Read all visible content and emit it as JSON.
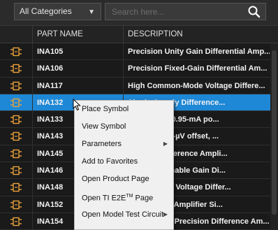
{
  "toolbar": {
    "category_value": "All Categories",
    "search_placeholder": "Search here...",
    "dropdown_icon": "triangle-down-icon",
    "search_icon": "magnifier-icon"
  },
  "table": {
    "headers": {
      "part": "PART NAME",
      "desc": "DESCRIPTION"
    },
    "row_icon": "schematic-symbol-icon",
    "rows": [
      {
        "part": "INA105",
        "desc": "Precision Unity Gain Differential Amp..."
      },
      {
        "part": "INA106",
        "desc": "Precision Fixed-Gain Differential Am..."
      },
      {
        "part": "INA117",
        "desc": "High Common-Mode Voltage Differe..."
      },
      {
        "part": "INA132",
        "desc": "Single-Supply Difference..."
      },
      {
        "part": "INA133",
        "desc": "0-µV offset, 0.95-mA po..."
      },
      {
        "part": "INA143",
        "desc": "(5-V/µs), 250-µV offset, ..."
      },
      {
        "part": "INA145",
        "desc": "ble Gain Difference Ampli..."
      },
      {
        "part": "INA146",
        "desc": "e, Programmable Gain Di..."
      },
      {
        "part": "INA148",
        "desc": "mmon-Mode Voltage Differ..."
      },
      {
        "part": "INA152",
        "desc": "y Difference Amplifier Si..."
      },
      {
        "part": "INA154",
        "desc": "High Speed, Precision Difference Am..."
      }
    ]
  },
  "context_menu": {
    "items": [
      {
        "label": "Place Symbol"
      },
      {
        "label": "View Symbol"
      },
      {
        "label": "Parameters",
        "submenu": true
      },
      {
        "label": "Add to Favorites"
      },
      {
        "label": "Open Product Page"
      },
      {
        "label_pre": "Open TI E2E",
        "label_sup": "TM",
        "label_post": " Page"
      },
      {
        "label": "Open Model Test Circuit",
        "submenu": true
      }
    ]
  },
  "colors": {
    "selected_row": "#1e88d6",
    "icon_orange": "#e9a13b",
    "background": "#1a1a1a"
  },
  "selected_row_index": 3
}
